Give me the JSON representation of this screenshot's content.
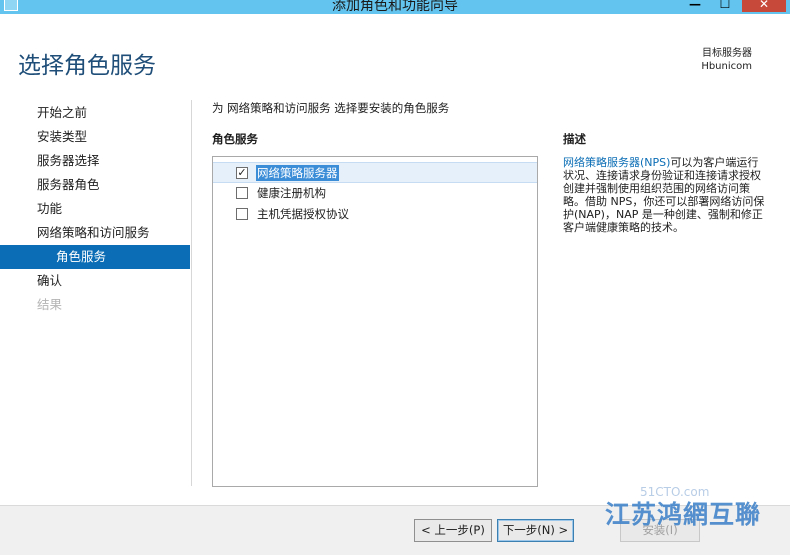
{
  "window": {
    "title": "添加角色和功能向导",
    "controls": {
      "minimize": "—",
      "maximize": "☐",
      "close": "✕"
    }
  },
  "header": {
    "page_title": "选择角色服务",
    "target_server_label": "目标服务器",
    "target_server_name": "Hbunicom"
  },
  "nav": {
    "items": [
      {
        "label": "开始之前",
        "state": "normal"
      },
      {
        "label": "安装类型",
        "state": "normal"
      },
      {
        "label": "服务器选择",
        "state": "normal"
      },
      {
        "label": "服务器角色",
        "state": "normal"
      },
      {
        "label": "功能",
        "state": "normal"
      },
      {
        "label": "网络策略和访问服务",
        "state": "normal"
      },
      {
        "label": "角色服务",
        "state": "active"
      },
      {
        "label": "确认",
        "state": "normal"
      },
      {
        "label": "结果",
        "state": "disabled"
      }
    ]
  },
  "main": {
    "instruction": "为 网络策略和访问服务 选择要安装的角色服务",
    "roles_header": "角色服务",
    "roles": [
      {
        "label": "网络策略服务器",
        "checked": true,
        "selected": true
      },
      {
        "label": "健康注册机构",
        "checked": false,
        "selected": false
      },
      {
        "label": "主机凭据授权协议",
        "checked": false,
        "selected": false
      }
    ],
    "description_header": "描述",
    "description_link": "网络策略服务器(NPS)",
    "description_text": "可以为客户端运行状况、连接请求身份验证和连接请求授权创建并强制使用组织范围的网络访问策略。借助 NPS，你还可以部署网络访问保护(NAP)，NAP 是一种创建、强制和修正客户端健康策略的技术。"
  },
  "footer": {
    "prev_label": "< 上一步(P)",
    "next_label": "下一步(N) >",
    "install_label": "安装(I)"
  },
  "watermark": {
    "text": "江苏鸿網互聯",
    "small": "51CTO.com"
  },
  "colors": {
    "title_bar": "#63c5ef",
    "accent": "#0a6db5",
    "page_title": "#1f4e79",
    "close_button": "#c7493a"
  }
}
